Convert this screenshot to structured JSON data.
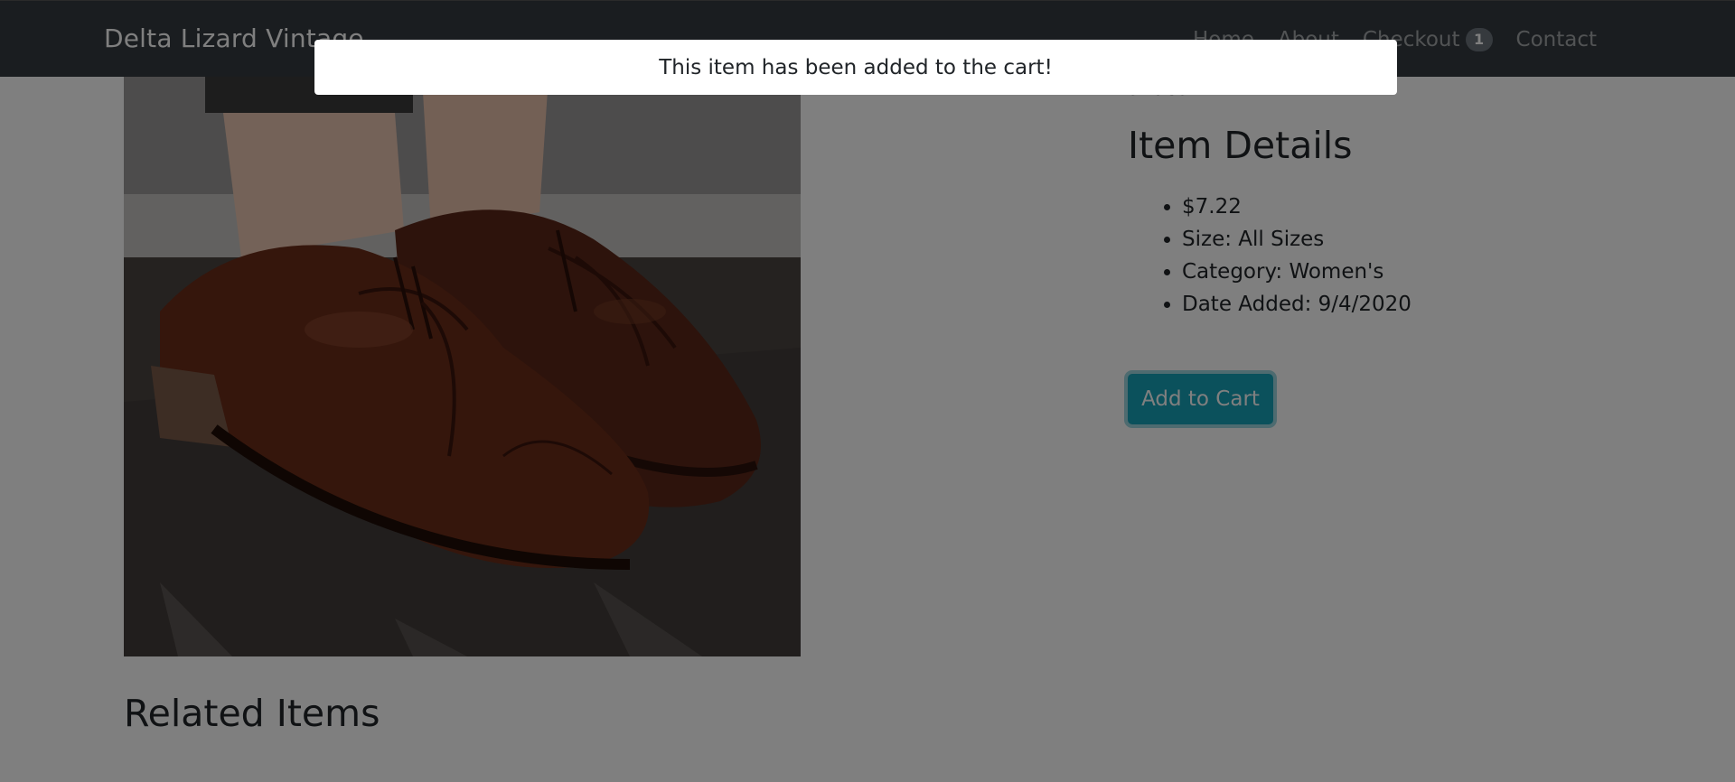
{
  "navbar": {
    "brand": "Delta Lizard Vintage",
    "links": {
      "home": "Home",
      "about": "About",
      "checkout": "Checkout",
      "checkout_badge": "1",
      "contact": "Contact"
    }
  },
  "product": {
    "image_alt": "Brown leather wingtip oxford shoes",
    "description_tail": "shoes.",
    "details_heading": "Item Details",
    "details": [
      "$7.22",
      "Size: All Sizes",
      "Category: Women's",
      "Date Added: 9/4/2020"
    ],
    "add_to_cart_label": "Add to Cart"
  },
  "related": {
    "heading": "Related Items"
  },
  "toast": {
    "message": "This item has been added to the cart!"
  },
  "colors": {
    "navbar_bg": "#343a40",
    "accent": "#17a2b8",
    "badge_bg": "#6c757d"
  }
}
